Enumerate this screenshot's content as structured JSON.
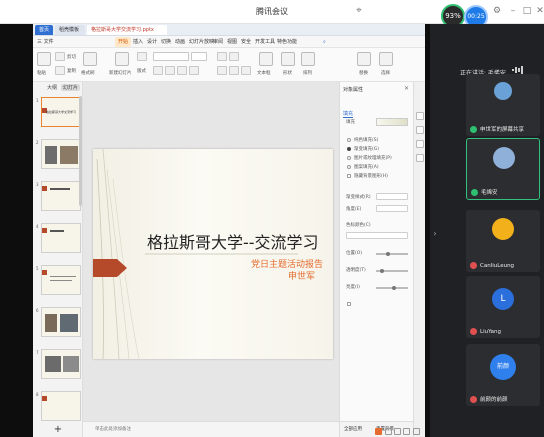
{
  "meeting": {
    "title": "腾讯会议",
    "recording_percent": "93%",
    "timer": "00:25"
  },
  "wps": {
    "tabs": {
      "home": "首页",
      "template": "稻壳模板",
      "file": "格拉斯哥大学交流学习.pptx"
    },
    "menu": [
      "三 文件",
      "开始",
      "插入",
      "设计",
      "切换",
      "动画",
      "幻灯片放映",
      "审阅",
      "视图",
      "安全",
      "开发工具",
      "特色功能"
    ],
    "ribbon": {
      "paste": "粘贴",
      "cut": "剪切",
      "copy": "复制",
      "format_painter": "格式刷",
      "new_slide": "新建幻灯片",
      "layout": "版式",
      "text_box": "文本框",
      "shape": "形状",
      "arrange": "排列",
      "replace": "替换",
      "select": "选择"
    },
    "left_panel": {
      "tab_outline": "大纲",
      "tab_slides": "幻灯片",
      "add_button": "+"
    },
    "slides": [
      {
        "num": "1",
        "title": "格拉斯哥大学交流学习"
      },
      {
        "num": "2",
        "title": ""
      },
      {
        "num": "3",
        "title": ""
      },
      {
        "num": "4",
        "title": ""
      },
      {
        "num": "5",
        "title": ""
      },
      {
        "num": "6",
        "title": ""
      },
      {
        "num": "7",
        "title": ""
      },
      {
        "num": "8",
        "title": ""
      }
    ],
    "slide": {
      "title": "格拉斯哥大学--交流学习",
      "subtitle": "党日主题活动报告",
      "author": "申世军"
    },
    "notes_placeholder": "单击此处添加备注",
    "pane": {
      "title": "对象属性",
      "tab_fill": "填充",
      "fill_label": "填充",
      "options": [
        "纯色填充(S)",
        "渐变填充(G)",
        "图片或纹理填充(P)",
        "图案填充(A)",
        "隐藏背景图形(H)"
      ],
      "selected_option": 1,
      "gradient_label": "渐变样式(R)",
      "angle_label": "角度(E)",
      "stops_label": "色标颜色(C)",
      "position_label": "位置(O)",
      "transparency_label": "透明度(T)",
      "brightness_label": "亮度(I)",
      "apply_all": "全部应用",
      "reset": "重置背景"
    }
  },
  "sidebar": {
    "speaking_label": "正在讲话: 毛烯安",
    "participants": [
      {
        "name": "申世军的屏幕共享",
        "mic": "on",
        "avatar_color": "#6aa2d8"
      },
      {
        "name": "毛烯安",
        "mic": "on",
        "avatar_color": "#8fb0d9"
      },
      {
        "name": "CanliuLeung",
        "mic": "off",
        "avatar_color": "#f2b11a"
      },
      {
        "name": "LiuYang",
        "mic": "off",
        "avatar_color": "#2a6fdb",
        "initial": "L"
      },
      {
        "name": "前颜的前颜",
        "mic": "off",
        "avatar_color": "#2f80ed",
        "initial": "前颜"
      }
    ]
  },
  "colors": {
    "accent": "#e56b2f",
    "wps_blue": "#2f6fd1",
    "meeting_green": "#2fbf71",
    "chevron_red": "#b44a2a"
  }
}
